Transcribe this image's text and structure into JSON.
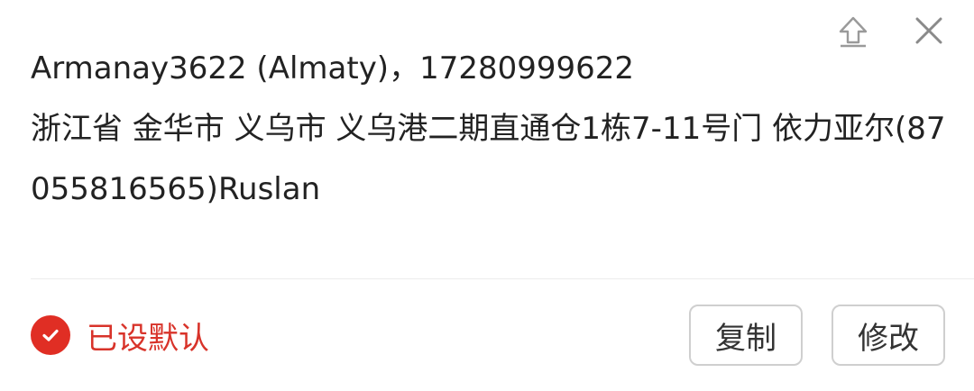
{
  "address": {
    "contact": "Armanay3622 (Almaty)，17280999622",
    "detail": "浙江省 金华市 义乌市 义乌港二期直通仓1栋7-11号门 依力亚尔(87055816565)Ruslan"
  },
  "toolbar": {
    "pin_icon": "pin-to-top-icon",
    "close_icon": "close-icon"
  },
  "footer": {
    "default_label": "已设默认",
    "copy_label": "复制",
    "edit_label": "修改"
  },
  "colors": {
    "accent": "#e02e24",
    "text": "#222222",
    "border": "#cfcfcf"
  }
}
